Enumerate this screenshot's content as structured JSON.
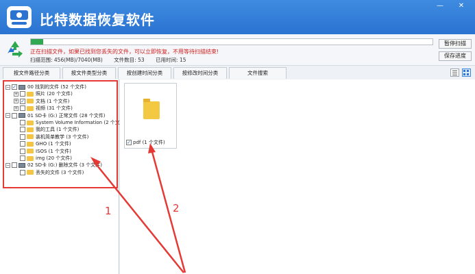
{
  "window": {
    "title": "比特数据恢复软件",
    "min_glyph": "—",
    "close_glyph": "✕"
  },
  "scan": {
    "progress_pct": 3,
    "message": "正在扫描文件，如果已找到您丢失的文件，可以立即恢复，不用等待扫描结束!",
    "range_label": "扫描范围: 456(MB)/7040(MB)",
    "found_label": "文件数目: 53",
    "elapsed_label": "已用时间: 15",
    "pause_button": "暂停扫描",
    "save_button": "保存进度"
  },
  "tabs": [
    "按文件路径分类",
    "按文件类型分类",
    "按创建时间分类",
    "按修改时间分类",
    "文件搜索"
  ],
  "tree": [
    {
      "label": "00 找到的文件 (52 个文件)",
      "level": 0,
      "expander": "−",
      "checked": true,
      "icon": "drive"
    },
    {
      "label": "照片 (20 个文件)",
      "level": 1,
      "expander": "+",
      "checked": false,
      "icon": "folder"
    },
    {
      "label": "文档 (1 个文件)",
      "level": 1,
      "expander": "+",
      "checked": true,
      "icon": "folder"
    },
    {
      "label": "视频 (31 个文件)",
      "level": 1,
      "expander": "+",
      "checked": false,
      "icon": "folder"
    },
    {
      "label": "01 SD卡 (G:) 正常文件 (28 个文件)",
      "level": 0,
      "expander": "−",
      "checked": false,
      "icon": "drive"
    },
    {
      "label": "System Volume Information (2 个文",
      "level": 1,
      "expander": "",
      "checked": false,
      "icon": "folder"
    },
    {
      "label": "我的工具 (1 个文件)",
      "level": 1,
      "expander": "",
      "checked": false,
      "icon": "folder"
    },
    {
      "label": "装机简单教学 (3 个文件)",
      "level": 1,
      "expander": "",
      "checked": false,
      "icon": "folder"
    },
    {
      "label": "GHO (1 个文件)",
      "level": 1,
      "expander": "",
      "checked": false,
      "icon": "folder"
    },
    {
      "label": "ISOS (1 个文件)",
      "level": 1,
      "expander": "",
      "checked": false,
      "icon": "folder"
    },
    {
      "label": "img (20 个文件)",
      "level": 1,
      "expander": "",
      "checked": false,
      "icon": "folder"
    },
    {
      "label": "02 SD卡 (G:) 删除文件 (3 个文件)",
      "level": 0,
      "expander": "−",
      "checked": false,
      "icon": "drive"
    },
    {
      "label": "丢失的文件 (3 个文件)",
      "level": 1,
      "expander": "",
      "checked": false,
      "icon": "folder"
    }
  ],
  "file_card": {
    "label": "pdf (1 个文件)",
    "checked": true,
    "icon": "folder-icon"
  },
  "annotations": {
    "label_1": "1",
    "label_2": "2",
    "color": "#e53935"
  },
  "colors": {
    "title_bar": "#2a73d1",
    "progress": "#2fa84f",
    "scan_message": "#d32020"
  }
}
